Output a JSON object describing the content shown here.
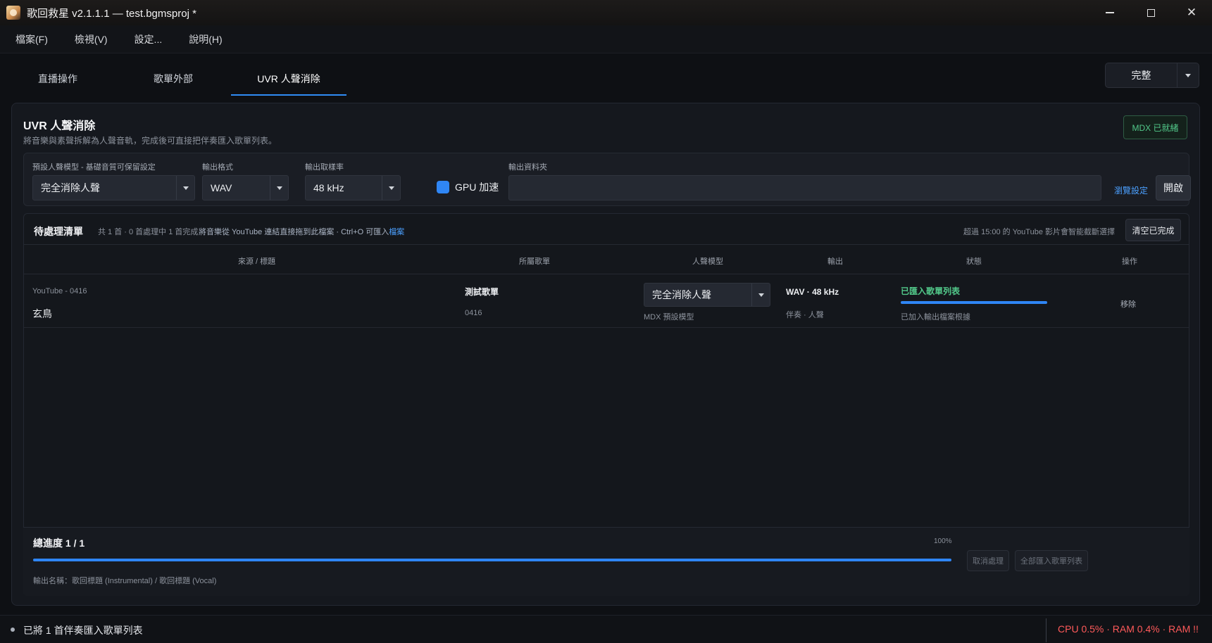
{
  "window": {
    "title": "歌回救星 v2.1.1.1 — test.bgmsproj *",
    "minimize": "min-icon",
    "maximize": "max-icon",
    "close": "✕"
  },
  "menu": [
    "檔案(F)",
    "檢視(V)",
    "設定...",
    "說明(H)"
  ],
  "tabs": [
    {
      "label": "直播操作"
    },
    {
      "label": "歌單外部"
    },
    {
      "label": "UVR 人聲消除"
    }
  ],
  "mode_button": {
    "label": "完整"
  },
  "panel": {
    "title": "UVR 人聲消除",
    "subtitle": "將音樂與素聲拆解為人聲音軌，完成後可直接把伴奏匯入歌單列表。",
    "status_badge": "MDX 已就緒"
  },
  "settings": {
    "model_label": "預設人聲模型 - 基礎音質可保留設定",
    "model_value": "完全消除人聲",
    "format_label": "輸出格式",
    "format_value": "WAV",
    "rate_label": "輸出取樣率",
    "rate_value": "48 kHz",
    "gpu_label": "GPU 加速",
    "gpu_checked": true,
    "folder_label": "輸出資料夾",
    "folder_value": "",
    "browse_label": "瀏覽設定",
    "open_label": "開啟"
  },
  "queue": {
    "title": "待處理清單",
    "count": "共 1 首 · 0 首處理中 1 首完成",
    "hint_prefix": "將音樂從 YouTube 連結直接拖到此檔案 · Ctrl+O 可匯入",
    "hint_link": "檔案",
    "note": "超過 15:00 的 YouTube 影片會智能截斷選擇",
    "clear_button": "清空已完成",
    "columns": {
      "source": "來源 / 標題",
      "playlist": "所屬歌單",
      "model": "人聲模型",
      "output": "輸出",
      "status": "狀態",
      "action": "操作"
    },
    "rows": [
      {
        "source": "YouTube - 0416",
        "title": "玄鳥",
        "playlist": "測試歌單",
        "playlist_id": "0416",
        "model": "完全消除人聲",
        "model_sub": "MDX 預設模型",
        "output": "WAV · 48 kHz",
        "output_sub": "伴奏 · 人聲",
        "status": "已匯入歌單列表",
        "progress": 1.0,
        "status_sub": "已加入輸出檔案根據",
        "action": "移除"
      }
    ]
  },
  "footer": {
    "title": "總進度 1 / 1",
    "percent": "100%",
    "progress": 1.0,
    "output_name": "輸出名稱：歌回標題 (Instrumental) / 歌回標題 (Vocal)",
    "cancel_button": "取消處理",
    "import_all_button": "全部匯入歌單列表"
  },
  "statusbar": {
    "message": "已將 1 首伴奏匯入歌單列表",
    "resources": "CPU 0.5% · RAM 0.4% · RAM !!"
  },
  "colors": {
    "accent": "#2f86f5",
    "success": "#52c98a",
    "warning": "#ff5a5a",
    "background": "#0e1014"
  }
}
